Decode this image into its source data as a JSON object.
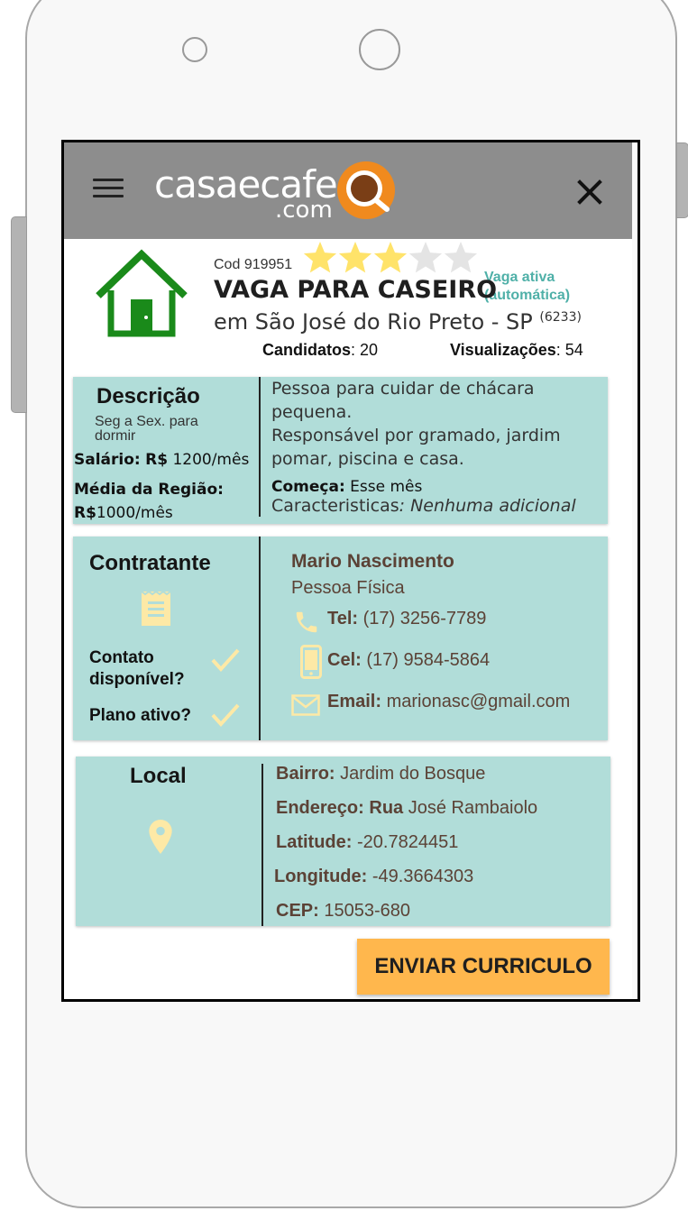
{
  "app": {
    "logo_text": "casaecafe",
    "logo_sub": ".com"
  },
  "listing": {
    "cod_label": "Cod",
    "cod": "919951",
    "rating": 3,
    "rating_max": 5,
    "status_line1": "Vaga ativa",
    "status_line2": "(automática)",
    "title": "VAGA PARA CASEIRO",
    "location": "em São José do Rio Preto - SP",
    "location_count": "(6233)",
    "candidates_label": "Candidatos",
    "candidates_value": ": 20",
    "views_label": "Visualizações",
    "views_value": ": 54"
  },
  "description": {
    "heading": "Descrição",
    "schedule_line1": "Seg a Sex. para",
    "schedule_line2": "dormir",
    "salary_label": "Salário:",
    "salary_currency": "R$",
    "salary_value": "1200/mês",
    "region_label": "Média da Região:",
    "region_currency": "R$",
    "region_value": "1000/mês",
    "text_line1": "Pessoa para cuidar de chácara",
    "text_line2": "pequena.",
    "text_line3": "Responsável por gramado, jardim",
    "text_line4": "pomar, piscina e casa.",
    "starts_label": "Começa:",
    "starts_value": "Esse mês",
    "features_label": "Caracteristicas",
    "features_value": ": Nenhuma adicional"
  },
  "contractor": {
    "heading": "Contratante",
    "contact_q1": "Contato",
    "contact_q2": "disponível?",
    "plan_q": "Plano ativo?",
    "name": "Mario Nascimento",
    "type": "Pessoa Física",
    "tel_label": "Tel:",
    "tel_value": "(17) 3256-7789",
    "cel_label": "Cel:",
    "cel_value": "(17) 9584-5864",
    "email_label": "Email:",
    "email_value": "marionasc@gmail.com"
  },
  "local": {
    "heading": "Local",
    "bairro_label": "Bairro:",
    "bairro_value": "Jardim do Bosque",
    "endereco_label": "Endereço:",
    "endereco_street_type": "Rua",
    "endereco_value": "José Rambaiolo",
    "latitude_label": "Latitude:",
    "latitude_value": "-20.7824451",
    "longitude_label": "Longitude:",
    "longitude_value": "-49.3664303",
    "cep_label": "CEP:",
    "cep_value": "15053-680"
  },
  "actions": {
    "send_label": "ENVIAR CURRICULO"
  },
  "colors": {
    "appbar": "#8d8d8d",
    "card": "#b1ddd9",
    "house_green": "#1a8a1a",
    "star_on": "#ffe36a",
    "star_off": "#e4e4e4",
    "icon_cream": "#fde9a6",
    "status_teal": "#4fb0a8",
    "button": "#ffb74d",
    "text_brown": "#5b4236"
  }
}
